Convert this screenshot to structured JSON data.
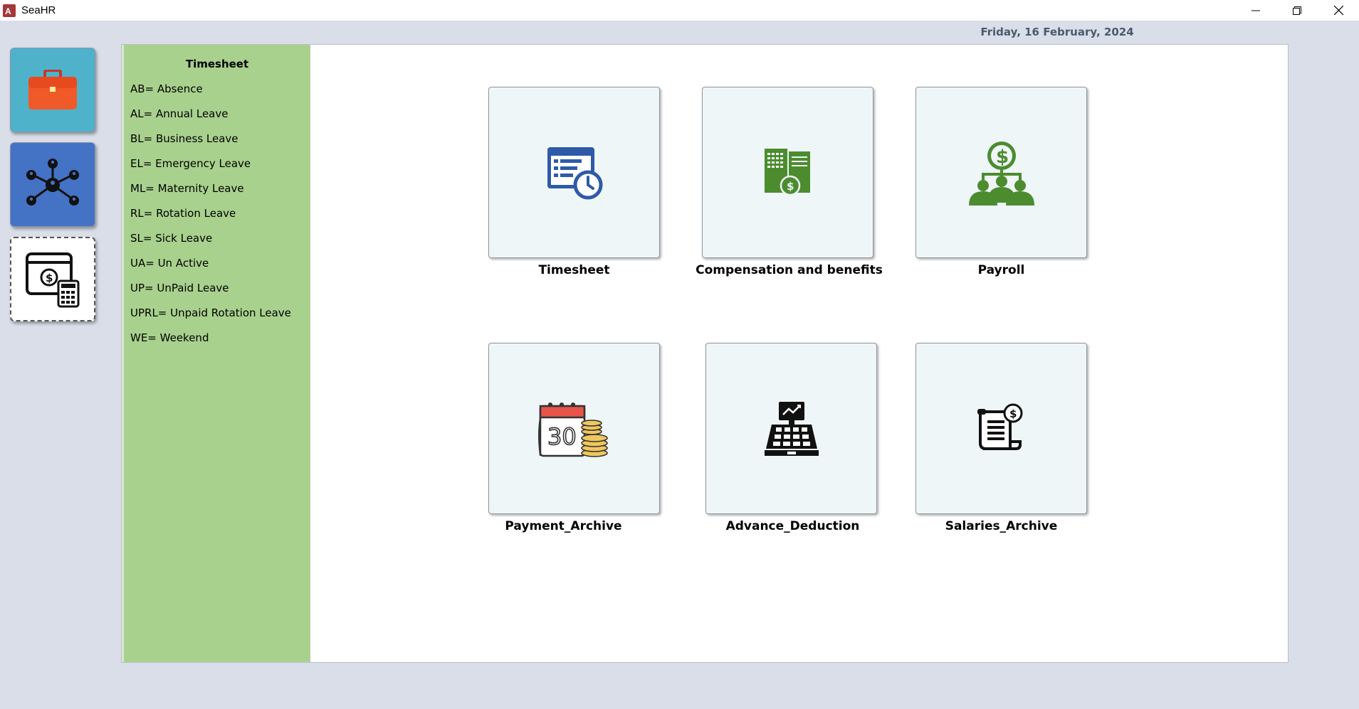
{
  "window": {
    "title": "SeaHR",
    "minimize_icon": "minimize-icon",
    "restore_icon": "restore-icon",
    "close_icon": "close-icon"
  },
  "header": {
    "date": "Friday, 16 February, 2024"
  },
  "sidebar": {
    "buttons": [
      {
        "icon": "briefcase-icon",
        "color": "#4fb2cb"
      },
      {
        "icon": "org-network-icon",
        "color": "#4472c4"
      },
      {
        "icon": "payroll-calculator-icon",
        "color": "#ffffff"
      }
    ]
  },
  "legend": {
    "title": "Timesheet",
    "items": [
      "AB= Absence",
      "AL= Annual Leave",
      "BL= Business Leave",
      "EL= Emergency Leave",
      "ML= Maternity Leave",
      "RL= Rotation Leave",
      "SL= Sick Leave",
      "UA= Un Active",
      "UP= UnPaid Leave",
      "UPRL= Unpaid Rotation Leave",
      "WE= Weekend"
    ]
  },
  "tiles": [
    {
      "label": "Timesheet",
      "icon": "timesheet-clock-icon"
    },
    {
      "label": "Compensation and benefits",
      "icon": "compensation-icon"
    },
    {
      "label": "Payroll",
      "icon": "payroll-dollar-people-icon"
    },
    {
      "label": "Payment_Archive",
      "icon": "calendar-coins-icon"
    },
    {
      "label": "Advance_Deduction",
      "icon": "cash-register-icon"
    },
    {
      "label": "Salaries_Archive",
      "icon": "salary-scroll-icon"
    }
  ],
  "colors": {
    "legend_bg": "#a9d18e",
    "tile_bg": "#eef6f8",
    "timesheet_icon": "#2e5aa8",
    "compensation_icon": "#4c8c2f",
    "payroll_icon": "#4c8c2f"
  }
}
